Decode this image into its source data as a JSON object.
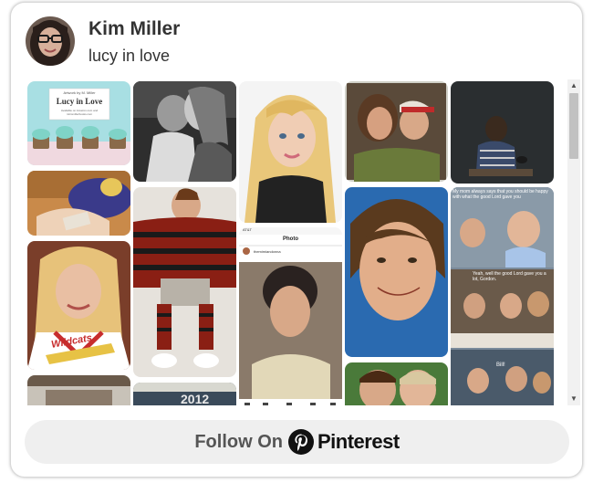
{
  "profile": {
    "name": "Kim Miller",
    "board_name": "lucy in love"
  },
  "pins": {
    "cupcake_card": {
      "byline": "Artwork by M. Miller",
      "title": "Lucy in Love",
      "subtitle": "Available on Amazon.com and mtimmillerbooks.com"
    },
    "social_screenshot": {
      "status": "AT&T",
      "header": "Photo",
      "username": "themimiandonna"
    },
    "meme": {
      "caption_top": "My mom always says that you should be happy with what the good Lord gave you",
      "caption_mid": "Yeah, well the good Lord gave you a lot, Gordon.",
      "caption_bottom": "Bill!"
    },
    "cheer_jersey_text": "Wildcats",
    "yearbook_text": "2012"
  },
  "follow_button": {
    "label": "Follow On",
    "brand": "Pinterest"
  },
  "colors": {
    "pinterest_red": "#e60023",
    "follow_bg": "#efefef",
    "text_dark": "#333333"
  },
  "icons": {
    "avatar": "avatar-photo",
    "logo": "pinterest-p-icon",
    "scroll_up": "scroll-up-arrow-icon",
    "scroll_down": "scroll-down-arrow-icon"
  }
}
